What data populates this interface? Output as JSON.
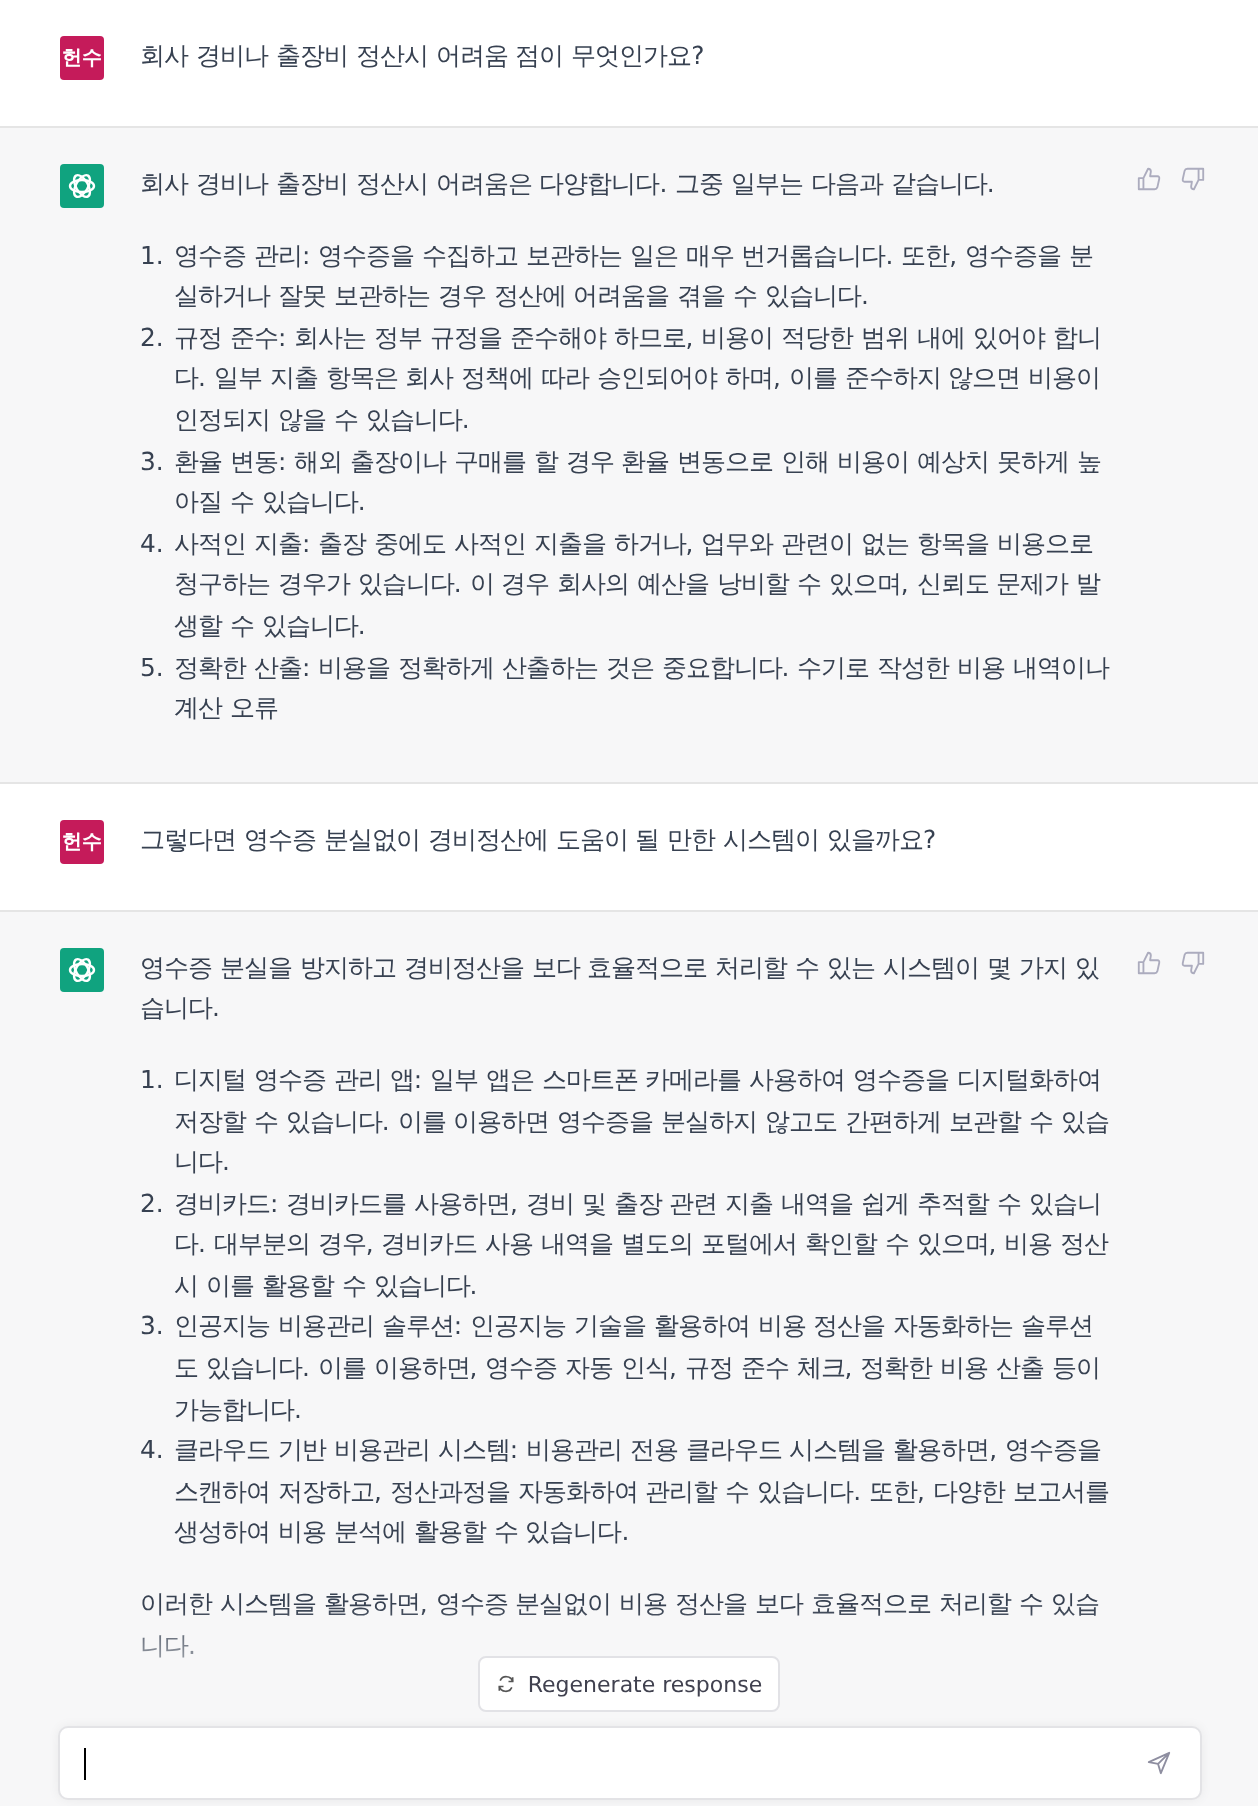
{
  "messages": [
    {
      "kind": "user",
      "avatar": "헌수",
      "text": "회사 경비나 출장비 정산시 어려움 점이 무엇인가요?"
    },
    {
      "kind": "assistant",
      "intro": "회사 경비나 출장비 정산시 어려움은 다양합니다. 그중 일부는 다음과 같습니다.",
      "items": [
        {
          "number": "1.",
          "text": "영수증 관리: 영수증을 수집하고 보관하는 일은 매우 번거롭습니다. 또한, 영수증을 분실하거나 잘못 보관하는 경우 정산에 어려움을 겪을 수 있습니다."
        },
        {
          "number": "2.",
          "text": "규정 준수: 회사는 정부 규정을 준수해야 하므로, 비용이 적당한 범위 내에 있어야 합니다. 일부 지출 항목은 회사 정책에 따라 승인되어야 하며, 이를 준수하지 않으면 비용이 인정되지 않을 수 있습니다."
        },
        {
          "number": "3.",
          "text": "환율 변동: 해외 출장이나 구매를 할 경우 환율 변동으로 인해 비용이 예상치 못하게 높아질 수 있습니다."
        },
        {
          "number": "4.",
          "text": "사적인 지출: 출장 중에도 사적인 지출을 하거나, 업무와 관련이 없는 항목을 비용으로 청구하는 경우가 있습니다. 이 경우 회사의 예산을 낭비할 수 있으며, 신뢰도 문제가 발생할 수 있습니다."
        },
        {
          "number": "5.",
          "text": "정확한 산출: 비용을 정확하게 산출하는 것은 중요합니다. 수기로 작성한 비용 내역이나 계산 오류"
        }
      ]
    },
    {
      "kind": "user",
      "avatar": "헌수",
      "text": "그렇다면 영수증 분실없이 경비정산에 도움이 될 만한 시스템이 있을까요?"
    },
    {
      "kind": "assistant",
      "intro": "영수증 분실을 방지하고 경비정산을 보다 효율적으로 처리할 수 있는 시스템이 몇 가지 있습니다.",
      "items": [
        {
          "number": "1.",
          "text": "디지털 영수증 관리 앱: 일부 앱은 스마트폰 카메라를 사용하여 영수증을 디지털화하여 저장할 수 있습니다. 이를 이용하면 영수증을 분실하지 않고도 간편하게 보관할 수 있습니다."
        },
        {
          "number": "2.",
          "text": "경비카드: 경비카드를 사용하면, 경비 및 출장 관련 지출 내역을 쉽게 추적할 수 있습니다. 대부분의 경우, 경비카드 사용 내역을 별도의 포털에서 확인할 수 있으며, 비용 정산 시 이를 활용할 수 있습니다."
        },
        {
          "number": "3.",
          "text": "인공지능 비용관리 솔루션: 인공지능 기술을 활용하여 비용 정산을 자동화하는 솔루션도 있습니다. 이를 이용하면, 영수증 자동 인식, 규정 준수 체크, 정확한 비용 산출 등이 가능합니다."
        },
        {
          "number": "4.",
          "text": "클라우드 기반 비용관리 시스템: 비용관리 전용 클라우드 시스템을 활용하면, 영수증을 스캔하여 저장하고, 정산과정을 자동화하여 관리할 수 있습니다. 또한, 다양한 보고서를 생성하여 비용 분석에 활용할 수 있습니다."
        }
      ],
      "outro": "이러한 시스템을 활용하면, 영수증 분실없이 비용 정산을 보다 효율적으로 처리할 수 있습니다."
    }
  ],
  "regenerate_button": "Regenerate response"
}
